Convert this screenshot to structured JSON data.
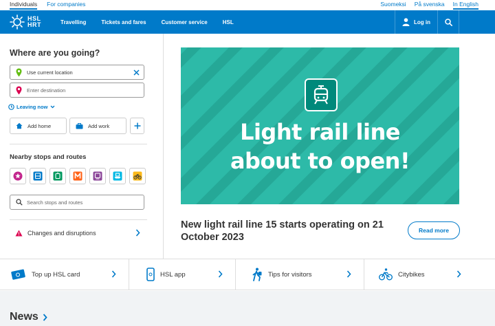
{
  "topbar": {
    "audience": [
      {
        "label": "Individuals",
        "active": true
      },
      {
        "label": "For companies",
        "active": false
      }
    ],
    "languages": [
      {
        "label": "Suomeksi",
        "active": false
      },
      {
        "label": "På svenska",
        "active": false
      },
      {
        "label": "In English",
        "active": true
      }
    ]
  },
  "nav": {
    "logo_top": "HSL",
    "logo_bottom": "HRT",
    "items": [
      "Travelling",
      "Tickets and fares",
      "Customer service",
      "HSL"
    ],
    "login": "Log in",
    "brand_color": "#007ac9"
  },
  "journey": {
    "title": "Where are you going?",
    "origin_value": "Use current location",
    "destination_placeholder": "Enter destination",
    "leaving": "Leaving now",
    "add_home": "Add home",
    "add_work": "Add work"
  },
  "nearby": {
    "title": "Nearby stops and routes",
    "modes": [
      "favourite-icon",
      "bus-icon",
      "tram-icon",
      "metro-icon",
      "train-icon",
      "ferry-icon",
      "citybike-icon"
    ],
    "search_placeholder": "Search stops and routes"
  },
  "disruptions": {
    "label": "Changes and disruptions"
  },
  "hero": {
    "line1": "Light rail line",
    "line2": "about to open!",
    "headline": "New light rail line 15 starts operating on 21 October 2023",
    "read_more": "Read more",
    "bg_color": "#2dbaa8"
  },
  "quick_links": [
    {
      "label": "Top up HSL card",
      "icon": "card-icon"
    },
    {
      "label": "HSL app",
      "icon": "phone-icon"
    },
    {
      "label": "Tips for visitors",
      "icon": "walker-icon"
    },
    {
      "label": "Citybikes",
      "icon": "bicycle-icon"
    }
  ],
  "news": {
    "title": "News"
  }
}
